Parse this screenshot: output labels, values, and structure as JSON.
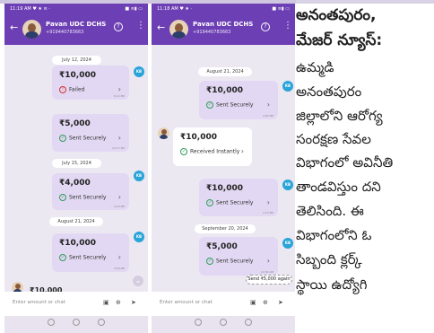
{
  "phone_left": {
    "status": {
      "time": "11:19 AM ♥ ★ ≡ ·",
      "icons": "■ ≡▮ ▭"
    },
    "header": {
      "name": "Pavan UDC DCHS",
      "phone": "+919440783663"
    },
    "dates": [
      "July 12, 2024",
      "July 15, 2024",
      "August 21, 2024"
    ],
    "cards": [
      {
        "amount": "₹10,000",
        "status": "Failed",
        "time": "6:12 PM"
      },
      {
        "amount": "₹5,000",
        "status": "Sent Securely",
        "time": "12:17 PM"
      },
      {
        "amount": "₹4,000",
        "status": "Sent Securely",
        "time": "4:23 PM"
      },
      {
        "amount": "₹10,000",
        "status": "Sent Securely",
        "time": "4:00 PM"
      }
    ],
    "partial_amount": "₹10,000",
    "input_placeholder": "Enter amount or chat",
    "kb": "KB"
  },
  "phone_right": {
    "status": {
      "time": "11:18 AM ♥ ★ ·",
      "icons": "■ ≡▮ ▭"
    },
    "header": {
      "name": "Pavan UDC DCHS",
      "phone": "+919440783663"
    },
    "dates": [
      "August 21, 2024",
      "September 20, 2024"
    ],
    "sent_cards": [
      {
        "amount": "₹10,000",
        "status": "Sent Securely",
        "time": "4:00 PM"
      },
      {
        "amount": "₹10,000",
        "status": "Sent Securely",
        "time": "3:13 PM"
      },
      {
        "amount": "₹5,000",
        "status": "Sent Securely",
        "time": "10:30 AM"
      }
    ],
    "received_card": {
      "amount": "₹10,000",
      "status": "Received Instantly",
      "time": "3:00 PM"
    },
    "send_again": "Send ₹5,000 again",
    "input_placeholder": "Enter amount or chat",
    "kb": "KB"
  },
  "article": {
    "lines": [
      "అనంతపురం,",
      "మేజర్ న్యూస్:",
      "ఉమ్మడి",
      "అనంతపురం",
      "జిల్లాలోని ఆరోగ్య",
      "సంరక్షణ సేవల",
      "విభాగంలో అవినీతి",
      "తాండవిస్తుం దని",
      "తెలిసింది. ఈ",
      "విభాగంలోని ఓ",
      "సిబ్బంది క్లర్క్",
      "స్థాయి ఉద్యోగి"
    ]
  }
}
